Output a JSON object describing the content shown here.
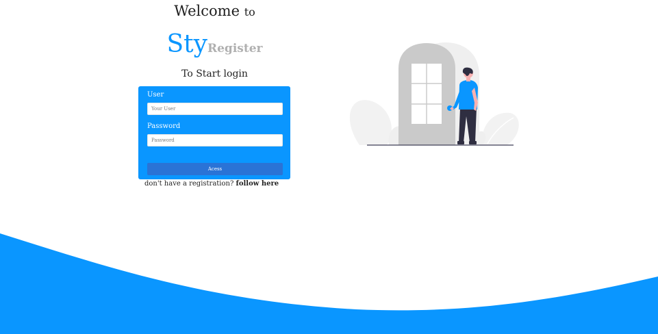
{
  "header": {
    "welcome_big": "Welcome",
    "welcome_small": "to",
    "brand_main": "Sty",
    "brand_sub": "Register",
    "subtitle": "To Start login"
  },
  "form": {
    "user_label": "User",
    "user_placeholder": "Your User",
    "password_label": "Password",
    "password_placeholder": "Password",
    "access_label": "Acess"
  },
  "footer": {
    "register_text": "don't have a registration?",
    "register_link": "follow here"
  },
  "colors": {
    "accent": "#0a96ff",
    "button": "#2a73d6",
    "brand_sub": "#b0b0b0",
    "wave": "#0a96ff"
  },
  "illustration": {
    "icon": "person-at-door-illustration"
  }
}
